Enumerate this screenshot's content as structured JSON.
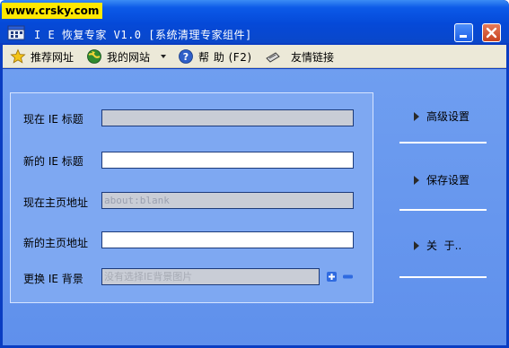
{
  "watermark": "www.crsky.com",
  "window": {
    "title": "I E 恢复专家 V1.0 [系统清理专家组件]",
    "minimize_icon": "minimize-icon",
    "close_icon": "close-icon"
  },
  "menu": {
    "items": [
      {
        "label": "推荐网址",
        "icon": "star-icon"
      },
      {
        "label": "我的网站",
        "icon": "globe-icon"
      },
      {
        "label": "帮 助 (F2)",
        "icon": "help-icon"
      },
      {
        "label": "友情链接",
        "icon": "link-icon"
      }
    ]
  },
  "form": {
    "current_title_label": "现在 IE 标题",
    "current_title_value": "",
    "new_title_label": "新的 IE 标题",
    "new_title_value": "",
    "current_home_label": "现在主页地址",
    "current_home_value": "about:blank",
    "new_home_label": "新的主页地址",
    "new_home_value": "",
    "background_label": "更换 IE 背景",
    "background_placeholder": "没有选择IE背景图片"
  },
  "side": {
    "advanced_label": "高级设置",
    "save_label": "保存设置",
    "about_label": "关  于.."
  },
  "colors": {
    "titlebar": "#0549d8",
    "client": "#6f9ef0",
    "panel": "#7ea8f2",
    "watermark_bg": "#ffe800"
  }
}
